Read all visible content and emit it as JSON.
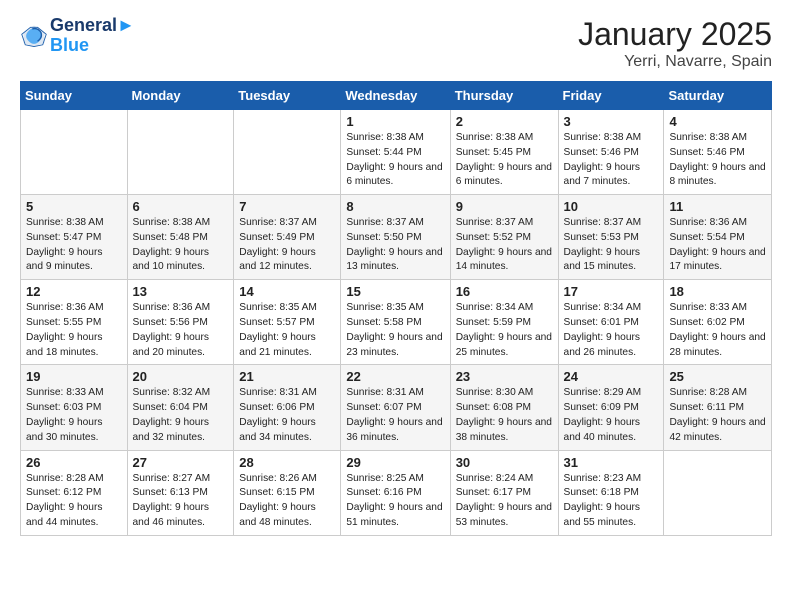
{
  "header": {
    "logo_line1": "General",
    "logo_line2": "Blue",
    "month_year": "January 2025",
    "location": "Yerri, Navarre, Spain"
  },
  "weekdays": [
    "Sunday",
    "Monday",
    "Tuesday",
    "Wednesday",
    "Thursday",
    "Friday",
    "Saturday"
  ],
  "weeks": [
    [
      {
        "day": "",
        "text": ""
      },
      {
        "day": "",
        "text": ""
      },
      {
        "day": "",
        "text": ""
      },
      {
        "day": "1",
        "text": "Sunrise: 8:38 AM\nSunset: 5:44 PM\nDaylight: 9 hours and 6 minutes."
      },
      {
        "day": "2",
        "text": "Sunrise: 8:38 AM\nSunset: 5:45 PM\nDaylight: 9 hours and 6 minutes."
      },
      {
        "day": "3",
        "text": "Sunrise: 8:38 AM\nSunset: 5:46 PM\nDaylight: 9 hours and 7 minutes."
      },
      {
        "day": "4",
        "text": "Sunrise: 8:38 AM\nSunset: 5:46 PM\nDaylight: 9 hours and 8 minutes."
      }
    ],
    [
      {
        "day": "5",
        "text": "Sunrise: 8:38 AM\nSunset: 5:47 PM\nDaylight: 9 hours and 9 minutes."
      },
      {
        "day": "6",
        "text": "Sunrise: 8:38 AM\nSunset: 5:48 PM\nDaylight: 9 hours and 10 minutes."
      },
      {
        "day": "7",
        "text": "Sunrise: 8:37 AM\nSunset: 5:49 PM\nDaylight: 9 hours and 12 minutes."
      },
      {
        "day": "8",
        "text": "Sunrise: 8:37 AM\nSunset: 5:50 PM\nDaylight: 9 hours and 13 minutes."
      },
      {
        "day": "9",
        "text": "Sunrise: 8:37 AM\nSunset: 5:52 PM\nDaylight: 9 hours and 14 minutes."
      },
      {
        "day": "10",
        "text": "Sunrise: 8:37 AM\nSunset: 5:53 PM\nDaylight: 9 hours and 15 minutes."
      },
      {
        "day": "11",
        "text": "Sunrise: 8:36 AM\nSunset: 5:54 PM\nDaylight: 9 hours and 17 minutes."
      }
    ],
    [
      {
        "day": "12",
        "text": "Sunrise: 8:36 AM\nSunset: 5:55 PM\nDaylight: 9 hours and 18 minutes."
      },
      {
        "day": "13",
        "text": "Sunrise: 8:36 AM\nSunset: 5:56 PM\nDaylight: 9 hours and 20 minutes."
      },
      {
        "day": "14",
        "text": "Sunrise: 8:35 AM\nSunset: 5:57 PM\nDaylight: 9 hours and 21 minutes."
      },
      {
        "day": "15",
        "text": "Sunrise: 8:35 AM\nSunset: 5:58 PM\nDaylight: 9 hours and 23 minutes."
      },
      {
        "day": "16",
        "text": "Sunrise: 8:34 AM\nSunset: 5:59 PM\nDaylight: 9 hours and 25 minutes."
      },
      {
        "day": "17",
        "text": "Sunrise: 8:34 AM\nSunset: 6:01 PM\nDaylight: 9 hours and 26 minutes."
      },
      {
        "day": "18",
        "text": "Sunrise: 8:33 AM\nSunset: 6:02 PM\nDaylight: 9 hours and 28 minutes."
      }
    ],
    [
      {
        "day": "19",
        "text": "Sunrise: 8:33 AM\nSunset: 6:03 PM\nDaylight: 9 hours and 30 minutes."
      },
      {
        "day": "20",
        "text": "Sunrise: 8:32 AM\nSunset: 6:04 PM\nDaylight: 9 hours and 32 minutes."
      },
      {
        "day": "21",
        "text": "Sunrise: 8:31 AM\nSunset: 6:06 PM\nDaylight: 9 hours and 34 minutes."
      },
      {
        "day": "22",
        "text": "Sunrise: 8:31 AM\nSunset: 6:07 PM\nDaylight: 9 hours and 36 minutes."
      },
      {
        "day": "23",
        "text": "Sunrise: 8:30 AM\nSunset: 6:08 PM\nDaylight: 9 hours and 38 minutes."
      },
      {
        "day": "24",
        "text": "Sunrise: 8:29 AM\nSunset: 6:09 PM\nDaylight: 9 hours and 40 minutes."
      },
      {
        "day": "25",
        "text": "Sunrise: 8:28 AM\nSunset: 6:11 PM\nDaylight: 9 hours and 42 minutes."
      }
    ],
    [
      {
        "day": "26",
        "text": "Sunrise: 8:28 AM\nSunset: 6:12 PM\nDaylight: 9 hours and 44 minutes."
      },
      {
        "day": "27",
        "text": "Sunrise: 8:27 AM\nSunset: 6:13 PM\nDaylight: 9 hours and 46 minutes."
      },
      {
        "day": "28",
        "text": "Sunrise: 8:26 AM\nSunset: 6:15 PM\nDaylight: 9 hours and 48 minutes."
      },
      {
        "day": "29",
        "text": "Sunrise: 8:25 AM\nSunset: 6:16 PM\nDaylight: 9 hours and 51 minutes."
      },
      {
        "day": "30",
        "text": "Sunrise: 8:24 AM\nSunset: 6:17 PM\nDaylight: 9 hours and 53 minutes."
      },
      {
        "day": "31",
        "text": "Sunrise: 8:23 AM\nSunset: 6:18 PM\nDaylight: 9 hours and 55 minutes."
      },
      {
        "day": "",
        "text": ""
      }
    ]
  ]
}
